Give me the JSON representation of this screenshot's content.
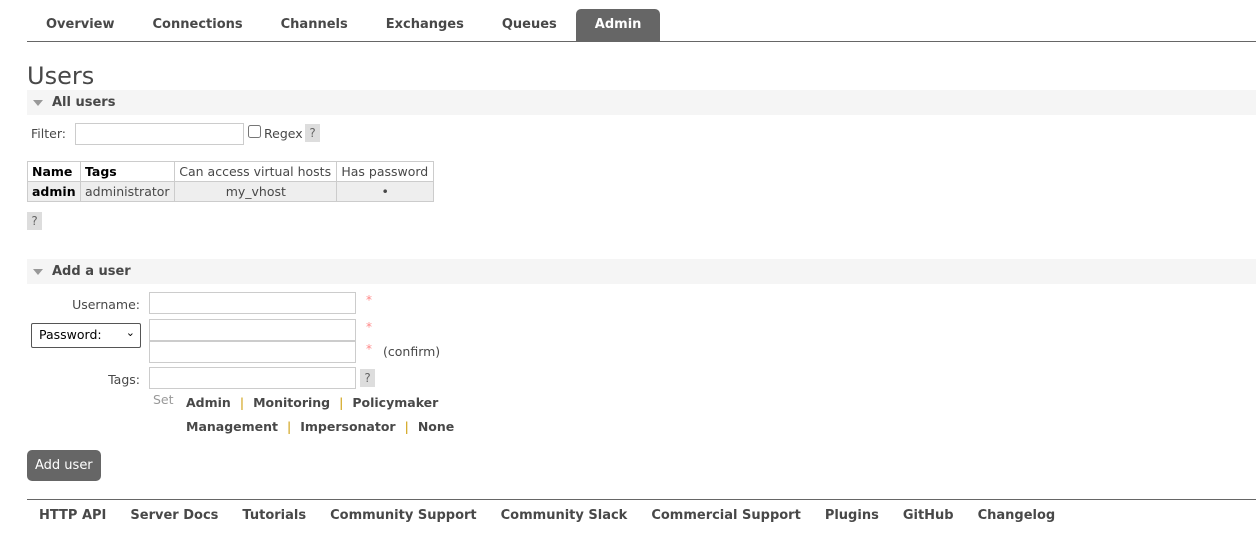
{
  "tabs": [
    "Overview",
    "Connections",
    "Channels",
    "Exchanges",
    "Queues",
    "Admin"
  ],
  "active_tab": "Admin",
  "page_title": "Users",
  "all_users": {
    "title": "All users",
    "filter_label": "Filter:",
    "filter_value": "",
    "regex_label": "Regex",
    "help": "?",
    "columns": [
      "Name",
      "Tags",
      "Can access virtual hosts",
      "Has password"
    ],
    "rows": [
      {
        "name": "admin",
        "tags": "administrator",
        "vhosts": "my_vhost",
        "has_password": "•"
      }
    ]
  },
  "add_user": {
    "title": "Add a user",
    "username_label": "Username:",
    "password_select": "Password:",
    "tags_label": "Tags:",
    "required": "*",
    "confirm": "(confirm)",
    "help": "?",
    "set_label": "Set",
    "tag_options": [
      "Admin",
      "Monitoring",
      "Policymaker",
      "Management",
      "Impersonator",
      "None"
    ],
    "separator": "|",
    "button": "Add user"
  },
  "footer": [
    "HTTP API",
    "Server Docs",
    "Tutorials",
    "Community Support",
    "Community Slack",
    "Commercial Support",
    "Plugins",
    "GitHub",
    "Changelog"
  ]
}
